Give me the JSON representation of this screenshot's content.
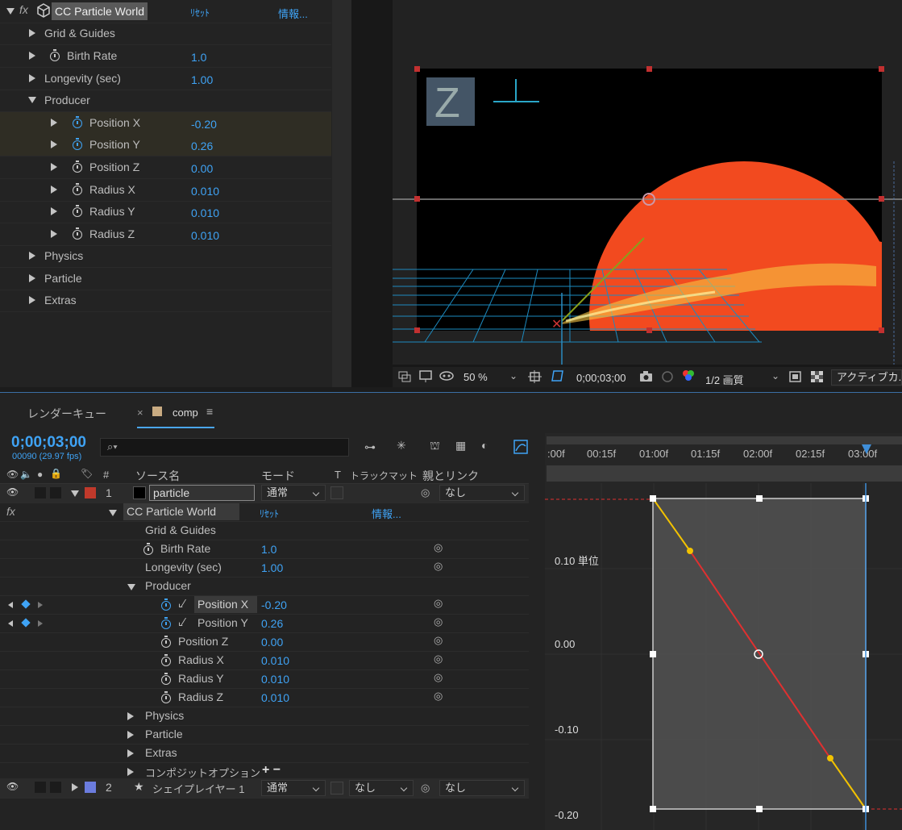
{
  "effect_controls": {
    "effect_name": "CC Particle World",
    "fx_label": "fx",
    "reset_label": "ﾘｾｯﾄ",
    "about_label": "情報...",
    "props": {
      "grid": "Grid & Guides",
      "birth_rate": {
        "label": "Birth Rate",
        "value": "1.0"
      },
      "longevity": {
        "label": "Longevity (sec)",
        "value": "1.00"
      },
      "producer": "Producer",
      "pos_x": {
        "label": "Position X",
        "value": "-0.20"
      },
      "pos_y": {
        "label": "Position Y",
        "value": "0.26"
      },
      "pos_z": {
        "label": "Position Z",
        "value": "0.00"
      },
      "rad_x": {
        "label": "Radius X",
        "value": "0.010"
      },
      "rad_y": {
        "label": "Radius Y",
        "value": "0.010"
      },
      "rad_z": {
        "label": "Radius Z",
        "value": "0.010"
      },
      "physics": "Physics",
      "particle": "Particle",
      "extras": "Extras"
    }
  },
  "viewer": {
    "zoom": "50 %",
    "timecode": "0;00;03;00",
    "resolution": "1/2 画質",
    "camera": "アクティブカ..."
  },
  "timeline": {
    "tab_render": "レンダーキュー",
    "tab_comp": "comp",
    "timecode": "0;00;03;00",
    "frame_info": "00090 (29.97 fps)",
    "search_placeholder": "",
    "columns": {
      "num": "#",
      "source": "ソース名",
      "mode": "モード",
      "t": "T",
      "track_matte": "トラックマット",
      "parent": "親とリンク"
    },
    "ruler": [
      ":00f",
      "00:15f",
      "01:00f",
      "01:15f",
      "02:00f",
      "02:15f",
      "03:00f"
    ],
    "layer1": {
      "num": "1",
      "name": "particle",
      "mode": "通常",
      "parent": "なし"
    },
    "layer2": {
      "num": "2",
      "name": "シェイプレイヤー 1",
      "mode": "通常",
      "matte": "なし",
      "parent": "なし"
    },
    "composite_options": "コンポジットオプション",
    "composite_plus_minus": "+ −"
  },
  "graph": {
    "labels": [
      "0.10 単位",
      "0.00",
      "-0.10",
      "-0.20"
    ]
  },
  "colors": {
    "accent": "#3fa3f5",
    "sun": "#f24a1f",
    "layer1_label": "#c0392b",
    "layer2_label": "#6b7cde"
  }
}
